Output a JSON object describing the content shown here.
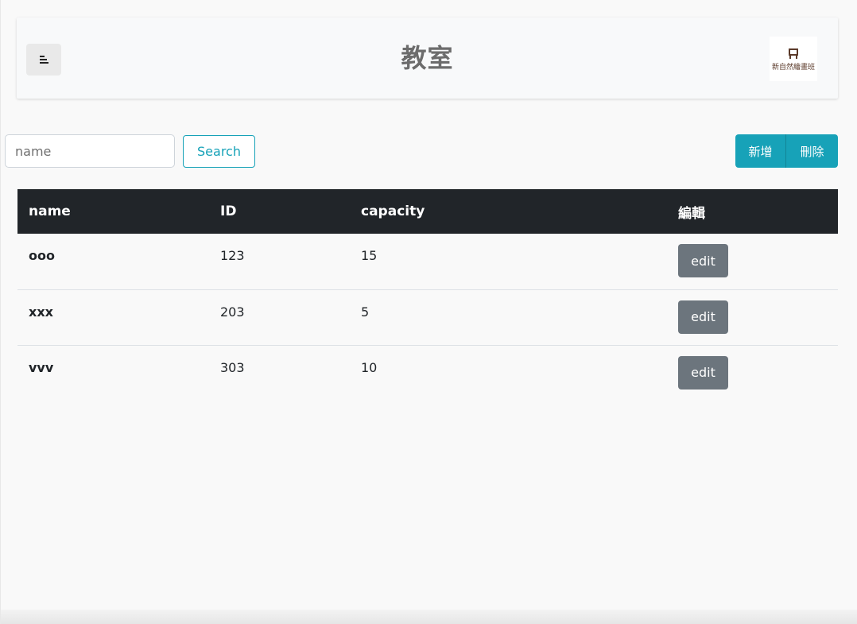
{
  "header": {
    "title": "教室",
    "logo_text": "新自然繪畫班"
  },
  "toolbar": {
    "search_placeholder": "name",
    "search_value": "",
    "search_label": "Search",
    "add_label": "新增",
    "delete_label": "刪除"
  },
  "table": {
    "columns": [
      "name",
      "ID",
      "capacity",
      "編輯"
    ],
    "rows": [
      {
        "name": "ooo",
        "id": "123",
        "capacity": "15",
        "action": "edit"
      },
      {
        "name": "xxx",
        "id": "203",
        "capacity": "5",
        "action": "edit"
      },
      {
        "name": "vvv",
        "id": "303",
        "capacity": "10",
        "action": "edit"
      }
    ]
  },
  "colors": {
    "accent": "#17a2b8",
    "table_header": "#212529",
    "edit_button": "#6c757d"
  },
  "icons": {
    "menu": "menu-icon",
    "logo": "logo-icon"
  }
}
